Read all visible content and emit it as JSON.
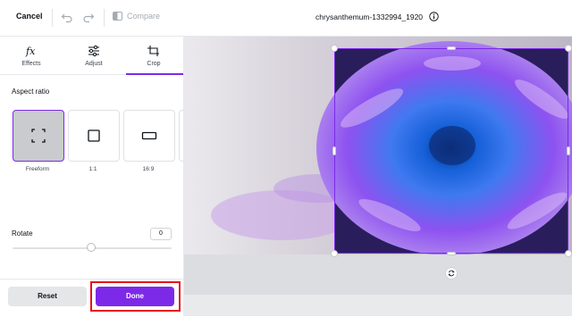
{
  "topbar": {
    "cancel_label": "Cancel",
    "compare_label": "Compare",
    "filename": "chrysanthemum-1332994_1920"
  },
  "panel": {
    "tabs": [
      {
        "label": "Effects",
        "icon": "fx-icon"
      },
      {
        "label": "Adjust",
        "icon": "sliders-icon"
      },
      {
        "label": "Crop",
        "icon": "crop-icon",
        "active": true
      }
    ],
    "aspect_ratio_title": "Aspect ratio",
    "ratios": [
      {
        "label": "Freeform",
        "selected": true
      },
      {
        "label": "1:1"
      },
      {
        "label": "16:9"
      }
    ],
    "rotate_label": "Rotate",
    "rotate_value": "0",
    "reset_label": "Reset",
    "done_label": "Done"
  },
  "colors": {
    "accent": "#7d2ae8",
    "highlight": "#e3151a"
  }
}
